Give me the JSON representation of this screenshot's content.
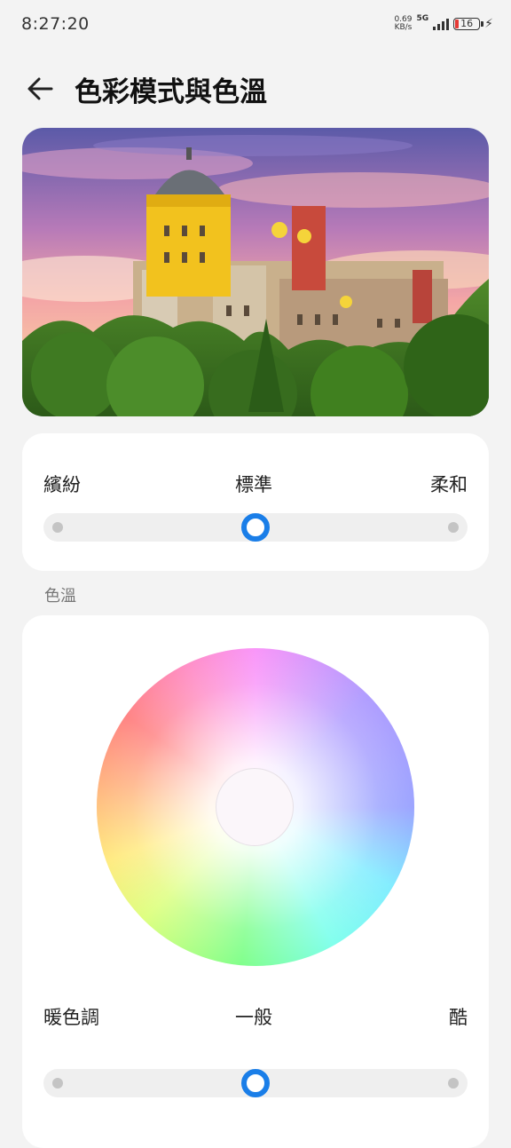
{
  "status_bar": {
    "time": "8:27:20",
    "speed_value": "0.69",
    "speed_unit": "KB/s",
    "network": "5G",
    "battery": "16"
  },
  "header": {
    "title": "色彩模式與色溫",
    "back_icon": "arrow-left-icon"
  },
  "color_mode": {
    "options": [
      "繽紛",
      "標準",
      "柔和"
    ],
    "selected": "標準",
    "selected_index": 1
  },
  "color_temperature": {
    "section_title": "色溫",
    "options": [
      "暖色調",
      "一般",
      "酷"
    ],
    "selected": "一般",
    "selected_index": 1
  },
  "colors": {
    "accent": "#1a7ee8",
    "background": "#f3f3f3",
    "card": "#ffffff"
  }
}
